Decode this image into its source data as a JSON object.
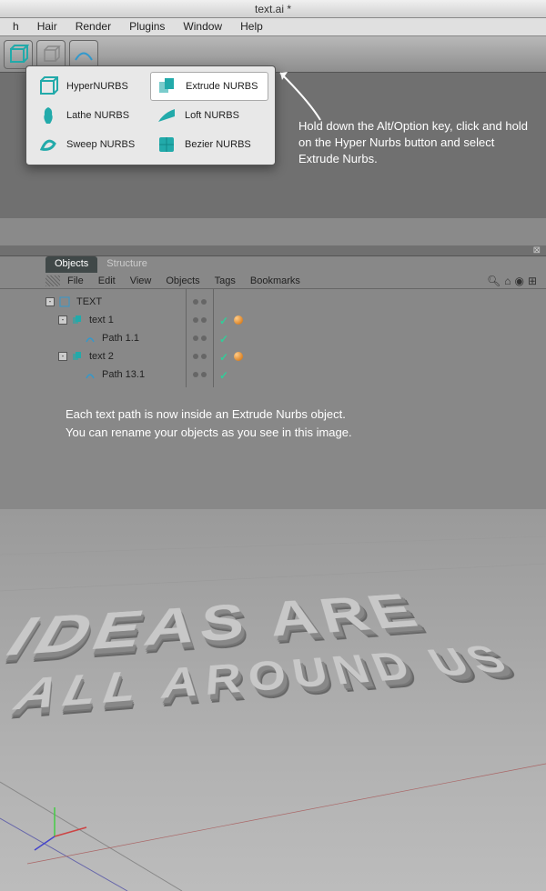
{
  "window": {
    "title": "text.ai *"
  },
  "menubar": {
    "items": [
      "h",
      "Hair",
      "Render",
      "Plugins",
      "Window",
      "Help"
    ]
  },
  "nurbs_menu": {
    "items": [
      {
        "label": "HyperNURBS",
        "selected": false
      },
      {
        "label": "Extrude NURBS",
        "selected": true
      },
      {
        "label": "Lathe NURBS",
        "selected": false
      },
      {
        "label": "Loft NURBS",
        "selected": false
      },
      {
        "label": "Sweep NURBS",
        "selected": false
      },
      {
        "label": "Bezier NURBS",
        "selected": false
      }
    ]
  },
  "annotation1": "Hold down the Alt/Option key, click and hold on the Hyper Nurbs button and select Extrude Nurbs.",
  "panel": {
    "tabs": [
      {
        "label": "Objects",
        "active": true
      },
      {
        "label": "Structure",
        "active": false
      }
    ],
    "menus": [
      "File",
      "Edit",
      "View",
      "Objects",
      "Tags",
      "Bookmarks"
    ]
  },
  "tree": {
    "root": "TEXT",
    "children": [
      {
        "name": "text 1",
        "children": [
          {
            "name": "Path 1.1"
          }
        ]
      },
      {
        "name": "text 2",
        "children": [
          {
            "name": "Path 13.1"
          }
        ]
      }
    ]
  },
  "annotation2_line1": "Each text path is now inside an Extrude Nurbs object.",
  "annotation2_line2": "You can rename your objects as you see in this image.",
  "viewport_text": {
    "line1": "IDEAS ARE",
    "line2": "ALL AROUND US"
  }
}
